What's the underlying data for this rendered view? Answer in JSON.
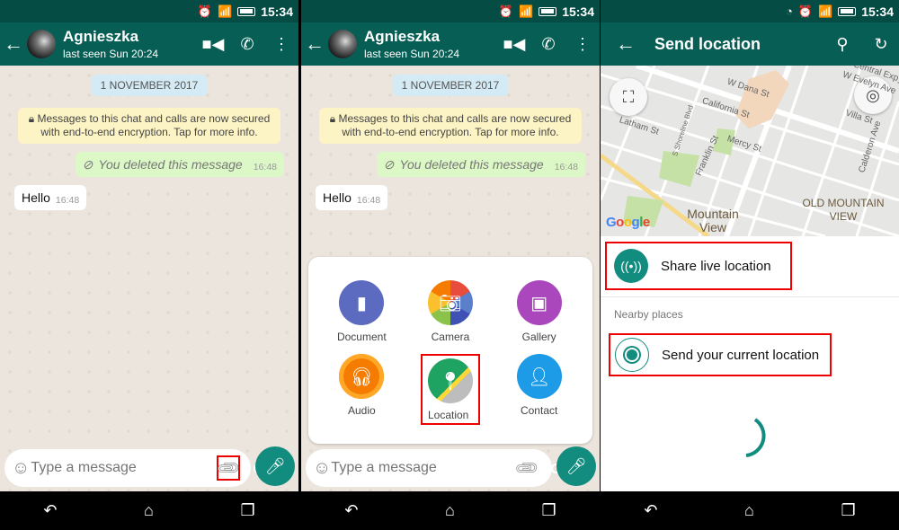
{
  "status_bar": {
    "time": "15:34",
    "icons": [
      "alarm-icon",
      "wifi-icon",
      "signal-roaming-icon",
      "battery-icon"
    ]
  },
  "panel3_status_icons": [
    "nfc-icon",
    "alarm-icon",
    "wifi-icon",
    "signal-roaming-icon",
    "battery-icon"
  ],
  "chat": {
    "contact_name": "Agnieszka",
    "last_seen": "last seen Sun 20:24",
    "date_pill": "1 NOVEMBER 2017",
    "encryption_notice": "Messages to this chat and calls are now secured with end-to-end encryption. Tap for more info.",
    "messages": [
      {
        "direction": "outgoing",
        "text": "You deleted this message",
        "time": "16:48",
        "deleted": true
      },
      {
        "direction": "incoming",
        "text": "Hello",
        "time": "16:48"
      }
    ],
    "input_placeholder": "Type a message"
  },
  "attach_menu": {
    "options": [
      {
        "label": "Document",
        "color": "#5c6bc0"
      },
      {
        "label": "Camera",
        "color": "#f57c00"
      },
      {
        "label": "Gallery",
        "color": "#ab47bc"
      },
      {
        "label": "Audio",
        "color": "#f57c00"
      },
      {
        "label": "Location",
        "color": "#1ea362",
        "highlighted": true
      },
      {
        "label": "Contact",
        "color": "#1e9be6"
      }
    ]
  },
  "send_location": {
    "title": "Send location",
    "map": {
      "attribution": "Google",
      "places": [
        "Mountain View",
        "OLD MOUNTAIN VIEW"
      ],
      "streets": [
        "W Dana St",
        "California St",
        "Latham St",
        "S Shoreline Blvd",
        "Mercy St",
        "Franklin St",
        "Villa St",
        "Calderon Ave",
        "Central Expy",
        "W Evelyn Ave"
      ]
    },
    "share_live": "Share live location",
    "nearby_header": "Nearby places",
    "send_current": "Send your current location"
  },
  "colors": {
    "header": "#075e54",
    "statusbar": "#054d44",
    "accent": "#128c7e",
    "highlight": "#e00000"
  }
}
